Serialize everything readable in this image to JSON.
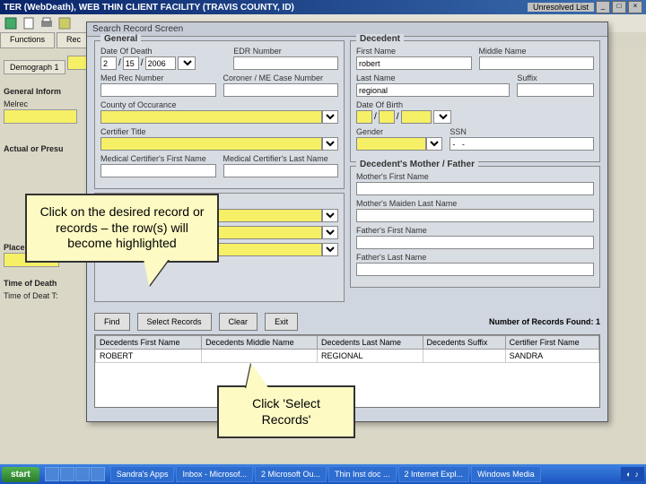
{
  "window": {
    "title": "TER (WebDeath), WEB THIN CLIENT FACILITY (TRAVIS COUNTY, ID)",
    "menu_right": "Unresolved List"
  },
  "tabs": [
    "Functions",
    "Rec"
  ],
  "bgform": {
    "demograph": "Demograph 1",
    "general_info": "General Inform",
    "melrec": "Melrec",
    "actual": "Actual or Presu",
    "place": "Place of Death",
    "time": "Time of Death",
    "timedet": "Time of Deat   T:"
  },
  "dialog": {
    "title": "Search Record Screen",
    "general": {
      "legend": "General",
      "dod": "Date Of Death",
      "dod_m": "2",
      "dod_d": "15",
      "dod_y": "2006",
      "edr": "EDR Number",
      "medrec": "Med Rec Number",
      "coroner": "Coroner / ME Case Number",
      "county": "County of Occurance",
      "certtitle": "Certifier Title",
      "mc_first": "Medical Certifier's First Name",
      "mc_last": "Medical Certifier's Last Name"
    },
    "decedent": {
      "legend": "Decedent",
      "first": "First Name",
      "first_v": "robert",
      "middle": "Middle Name",
      "last": "Last Name",
      "last_v": "regional",
      "suffix": "Suffix",
      "dob": "Date Of Birth",
      "gender": "Gender",
      "ssn": "SSN",
      "ssn_v": "-   -"
    },
    "mother": {
      "legend": "Decedent's Mother / Father",
      "m_first": "Mother's First Name",
      "m_maiden": "Mother's Maiden Last Name",
      "f_first": "Father's First Name",
      "f_last": "Father's Last Name"
    },
    "buttons": {
      "find": "Find",
      "select": "Select Records",
      "clear": "Clear",
      "exit": "Exit"
    },
    "count_label": "Number of Records Found:",
    "count": "1",
    "table": {
      "headers": [
        "Decedents First Name",
        "Decedents Middle Name",
        "Decedents Last Name",
        "Decedents Suffix",
        "Certifier First Name"
      ],
      "row": [
        "ROBERT",
        "",
        "REGIONAL",
        "",
        "SANDRA"
      ]
    }
  },
  "callouts": {
    "c1": "Click on the desired record or records – the row(s) will become highlighted",
    "c2": "Click 'Select Records'"
  },
  "taskbar": {
    "start": "start",
    "items": [
      "Sandra's Apps",
      "Inbox - Microsof...",
      "2 Microsoft Ou...",
      "Thin Inst doc ...",
      "2 Internet Expl...",
      "Windows Media"
    ]
  }
}
